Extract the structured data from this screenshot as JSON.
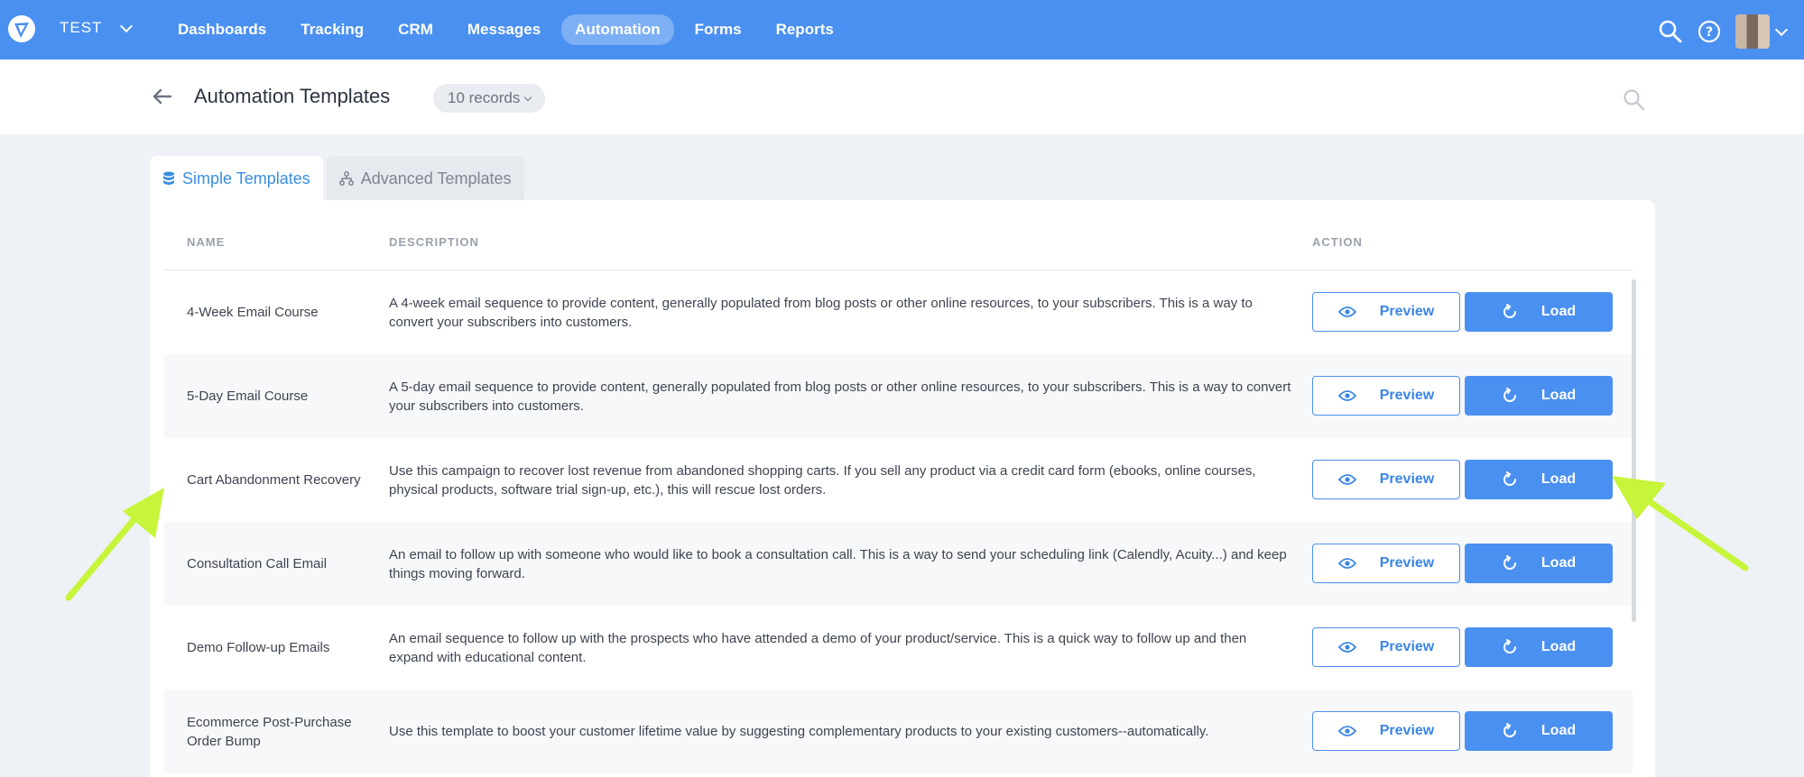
{
  "nav": {
    "account": "TEST",
    "items": [
      {
        "label": "Dashboards",
        "active": false
      },
      {
        "label": "Tracking",
        "active": false
      },
      {
        "label": "CRM",
        "active": false
      },
      {
        "label": "Messages",
        "active": false
      },
      {
        "label": "Automation",
        "active": true
      },
      {
        "label": "Forms",
        "active": false
      },
      {
        "label": "Reports",
        "active": false
      }
    ],
    "icons": {
      "logo": "brand-logo-icon",
      "search": "search-icon",
      "help": "help-icon"
    }
  },
  "header": {
    "title": "Automation Templates",
    "records": "10 records"
  },
  "tabs": [
    {
      "label": "Simple Templates",
      "icon": "database-icon",
      "active": true
    },
    {
      "label": "Advanced Templates",
      "icon": "sitemap-icon",
      "active": false
    }
  ],
  "table": {
    "columns": {
      "name": "NAME",
      "description": "DESCRIPTION",
      "action": "ACTION"
    },
    "preview_label": "Preview",
    "load_label": "Load",
    "rows": [
      {
        "name": "4-Week Email Course",
        "description": "A 4-week email sequence to provide content, generally populated from blog posts or other online resources, to your subscribers. This is a way to convert your subscribers into customers."
      },
      {
        "name": "5-Day Email Course",
        "description": "A 5-day email sequence to provide content, generally populated from blog posts or other online resources, to your subscribers. This is a way to convert your subscribers into customers."
      },
      {
        "name": "Cart Abandonment Recovery",
        "description": "Use this campaign to recover lost revenue from abandoned shopping carts. If you sell any product via a credit card form (ebooks, online courses, physical products, software trial sign-up, etc.), this will rescue lost orders."
      },
      {
        "name": "Consultation Call Email",
        "description": "An email to follow up with someone who would like to book a consultation call. This is a way to send your scheduling link (Calendly, Acuity...) and keep things moving forward."
      },
      {
        "name": "Demo Follow-up Emails",
        "description": "An email sequence to follow up with the prospects who have attended a demo of your product/service. This is a quick way to follow up and then expand with educational content."
      },
      {
        "name": "Ecommerce Post-Purchase Order Bump",
        "description": "Use this template to boost your customer lifetime value by suggesting complementary products to your existing customers--automatically."
      }
    ]
  },
  "colors": {
    "primary": "#4a90f0",
    "annotation_arrow": "#c6f53a"
  }
}
